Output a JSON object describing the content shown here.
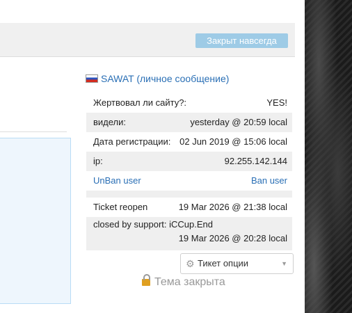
{
  "header": {
    "closed_badge": "Закрыт навсегда"
  },
  "user": {
    "name": "SAWAT",
    "pm_open": " (",
    "pm_label": "личное сообщение",
    "pm_close": ")"
  },
  "info": {
    "donated_label": "Жертвовал ли сайту?:",
    "donated_value": "YES!",
    "seen_label": "видели:",
    "seen_value": "yesterday @ 20:59 local",
    "reg_label": "Дата регистрации:",
    "reg_value": "02 Jun 2019 @ 15:06 local",
    "ip_label": "ip:",
    "ip_value": "92.255.142.144",
    "unban_label": "UnBan user",
    "ban_label": "Ban user",
    "reopen_label": "Ticket reopen",
    "reopen_value": "19 Mar 2026 @ 21:38 local",
    "closed_by_label": "closed by support: iCCup.End",
    "closed_by_value": "19 Mar 2026 @ 20:28 local"
  },
  "ticket_options": {
    "label": "Тикет опции",
    "icon": "gear-icon"
  },
  "topic_closed": {
    "label": "Тема закрыта",
    "icon": "lock-icon"
  },
  "colors": {
    "link": "#2a6fb5",
    "badge": "#9ecbe6",
    "row_shade": "#efefef"
  }
}
